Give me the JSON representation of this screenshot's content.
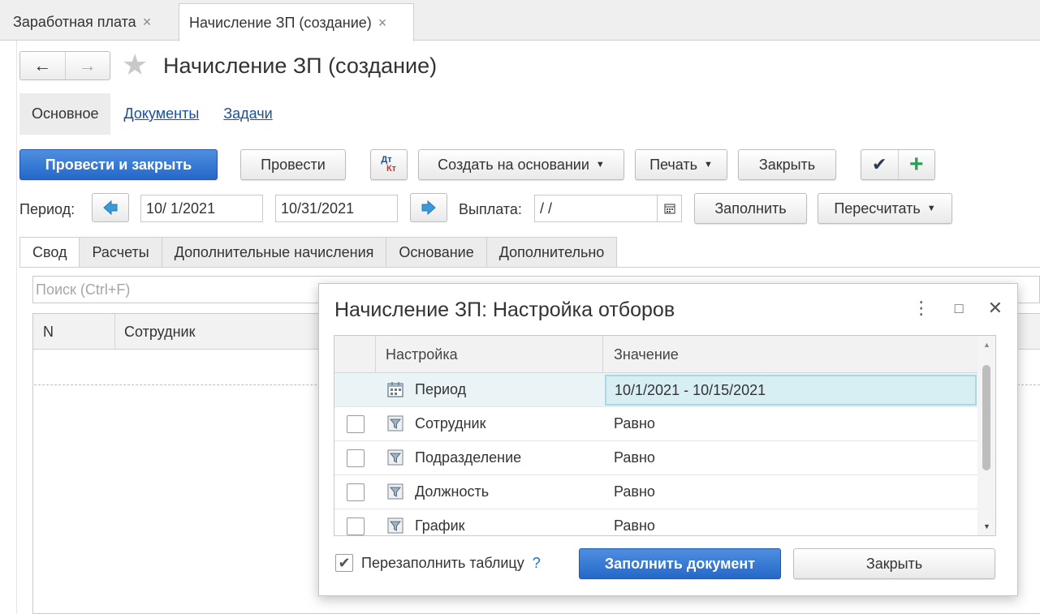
{
  "tabs": [
    {
      "label": "Заработная плата",
      "close": "×"
    },
    {
      "label": "Начисление ЗП (создание)",
      "close": "×"
    }
  ],
  "nav": {
    "back": "←",
    "forward": "→",
    "star": "★"
  },
  "page_title": "Начисление ЗП (создание)",
  "sections": {
    "active": "Основное",
    "links": [
      "Документы",
      "Задачи"
    ]
  },
  "toolbar": {
    "post_close": "Провести и закрыть",
    "post": "Провести",
    "dt": "Дт",
    "kt": "Кт",
    "create_based": "Создать на основании",
    "print": "Печать",
    "close": "Закрыть",
    "check": "✔",
    "add": "+"
  },
  "period": {
    "label": "Период:",
    "from": "10/ 1/2021",
    "to": "10/31/2021",
    "payout_label": "Выплата:",
    "payout_value": " /  /",
    "fill": "Заполнить",
    "recalc": "Пересчитать"
  },
  "lower_tabs": [
    "Свод",
    "Расчеты",
    "Дополнительные начисления",
    "Основание",
    "Дополнительно"
  ],
  "search": {
    "placeholder": "Поиск (Ctrl+F)"
  },
  "grid": {
    "col_n": "N",
    "col_employee": "Сотрудник"
  },
  "dialog": {
    "title": "Начисление ЗП: Настройка отборов",
    "menu_icon": "⋮",
    "maximize_icon": "□",
    "close_icon": "✕",
    "col_setting": "Настройка",
    "col_value": "Значение",
    "rows": [
      {
        "name": "Период",
        "value": "10/1/2021 - 10/15/2021"
      },
      {
        "name": "Сотрудник",
        "value": "Равно"
      },
      {
        "name": "Подразделение",
        "value": "Равно"
      },
      {
        "name": "Должность",
        "value": "Равно"
      },
      {
        "name": "График",
        "value": "Равно"
      }
    ],
    "refill_label": "Перезаполнить таблицу",
    "refill_checked": "✔",
    "help": "?",
    "fill_doc": "Заполнить документ",
    "close": "Закрыть"
  },
  "colors": {
    "accent": "#2468c9",
    "link": "#1a4f9c",
    "selection": "#d7eef3"
  }
}
